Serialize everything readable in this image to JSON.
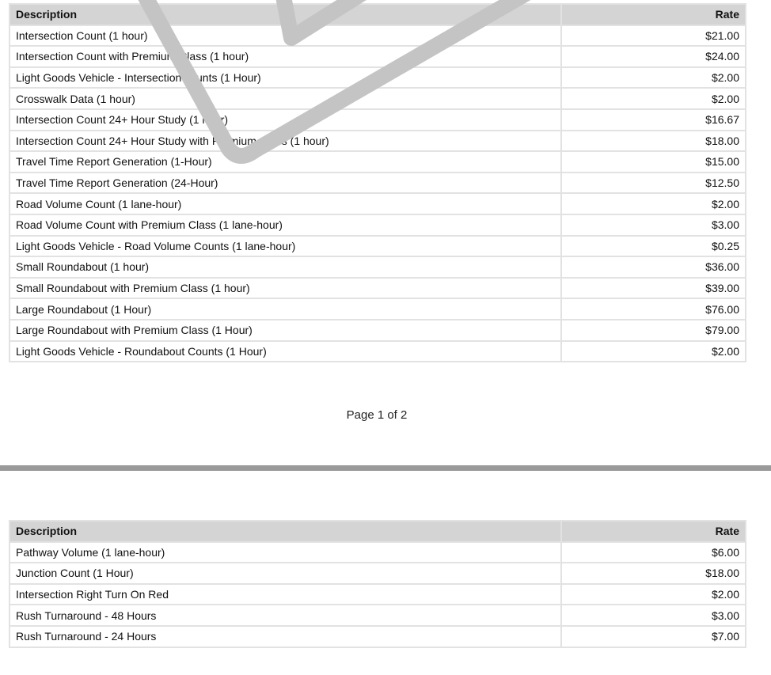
{
  "page1": {
    "header": {
      "description": "Description",
      "rate": "Rate"
    },
    "rows": [
      {
        "description": "Intersection Count (1 hour)",
        "rate": "$21.00"
      },
      {
        "description": "Intersection Count with Premium Class (1 hour)",
        "rate": "$24.00"
      },
      {
        "description": "Light Goods Vehicle - Intersection counts (1 Hour)",
        "rate": "$2.00"
      },
      {
        "description": "Crosswalk Data (1 hour)",
        "rate": "$2.00"
      },
      {
        "description": "Intersection Count 24+ Hour Study (1 hour)",
        "rate": "$16.67"
      },
      {
        "description": "Intersection Count 24+ Hour Study with Premium Class (1 hour)",
        "rate": "$18.00"
      },
      {
        "description": "Travel Time Report Generation (1-Hour)",
        "rate": "$15.00"
      },
      {
        "description": "Travel Time Report Generation (24-Hour)",
        "rate": "$12.50"
      },
      {
        "description": "Road Volume Count (1 lane-hour)",
        "rate": "$2.00"
      },
      {
        "description": "Road Volume Count with Premium Class (1 lane-hour)",
        "rate": "$3.00"
      },
      {
        "description": "Light Goods Vehicle - Road Volume Counts (1 lane-hour)",
        "rate": "$0.25"
      },
      {
        "description": "Small Roundabout (1 hour)",
        "rate": "$36.00"
      },
      {
        "description": "Small Roundabout with Premium Class (1 hour)",
        "rate": "$39.00"
      },
      {
        "description": "Large Roundabout (1 Hour)",
        "rate": "$76.00"
      },
      {
        "description": "Large Roundabout with Premium Class (1 Hour)",
        "rate": "$79.00"
      },
      {
        "description": "Light Goods Vehicle - Roundabout Counts (1 Hour)",
        "rate": "$2.00"
      }
    ],
    "page_number": "Page 1 of 2"
  },
  "page2": {
    "header": {
      "description": "Description",
      "rate": "Rate"
    },
    "rows": [
      {
        "description": "Pathway Volume (1 lane-hour)",
        "rate": "$6.00"
      },
      {
        "description": "Junction Count (1 Hour)",
        "rate": "$18.00"
      },
      {
        "description": "Intersection Right Turn On Red",
        "rate": "$2.00"
      },
      {
        "description": "Rush Turnaround - 48 Hours",
        "rate": "$3.00"
      },
      {
        "description": "Rush Turnaround - 24 Hours",
        "rate": "$7.00"
      }
    ]
  },
  "watermark": {
    "color": "#c4c4c4"
  }
}
